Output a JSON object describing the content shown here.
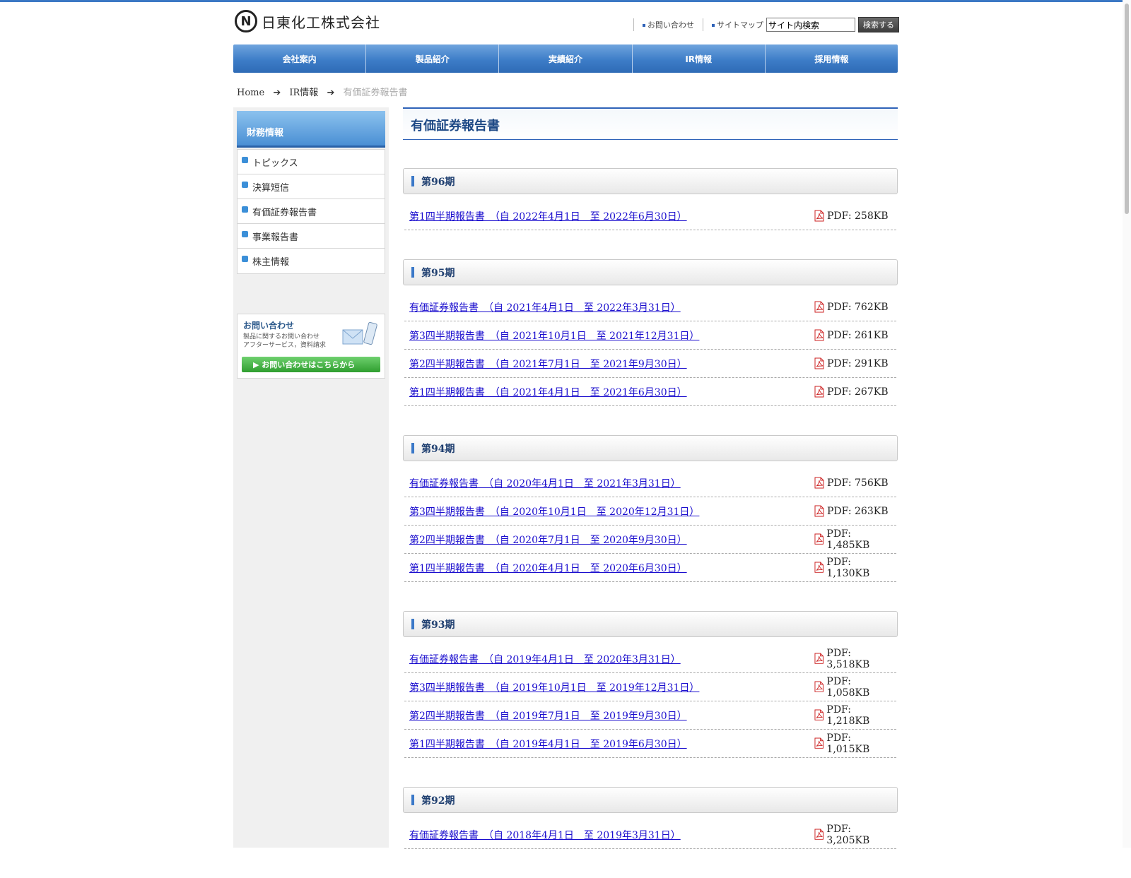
{
  "header": {
    "logo_mark": "N",
    "company": "日東化工株式会社",
    "contact_link": "お問い合わせ",
    "sitemap_link": "サイトマップ",
    "search_value": "サイト内検索",
    "search_button": "検索する"
  },
  "nav": [
    "会社案内",
    "製品紹介",
    "実績紹介",
    "IR情報",
    "採用情報"
  ],
  "breadcrumb": {
    "home": "Home",
    "arrow": "➔",
    "section": "IR情報",
    "current": "有価証券報告書"
  },
  "sidebar": {
    "title": "財務情報",
    "items": [
      "トピックス",
      "決算短信",
      "有価証券報告書",
      "事業報告書",
      "株主情報"
    ],
    "contact": {
      "title": "お問い合わせ",
      "desc1": "製品に関するお問い合わせ",
      "desc2": "アフターサービス，資料請求",
      "button": "お問い合わせはこちらから"
    }
  },
  "page_title": "有価証券報告書",
  "periods": [
    {
      "title": "第96期",
      "docs": [
        {
          "label": "第1四半期報告書　（自 2022年4月1日　至 2022年6月30日）",
          "size": "PDF: 258KB"
        }
      ]
    },
    {
      "title": "第95期",
      "docs": [
        {
          "label": "有価証券報告書　（自 2021年4月1日　至 2022年3月31日）",
          "size": "PDF: 762KB"
        },
        {
          "label": "第3四半期報告書　（自 2021年10月1日　至 2021年12月31日）",
          "size": "PDF: 261KB"
        },
        {
          "label": "第2四半期報告書　（自 2021年7月1日　至 2021年9月30日）",
          "size": "PDF: 291KB"
        },
        {
          "label": "第1四半期報告書　（自 2021年4月1日　至 2021年6月30日）",
          "size": "PDF: 267KB"
        }
      ]
    },
    {
      "title": "第94期",
      "docs": [
        {
          "label": "有価証券報告書　（自 2020年4月1日　至 2021年3月31日）",
          "size": "PDF: 756KB"
        },
        {
          "label": "第3四半期報告書　（自 2020年10月1日　至 2020年12月31日）",
          "size": "PDF: 263KB"
        },
        {
          "label": "第2四半期報告書　（自 2020年7月1日　至 2020年9月30日）",
          "size": "PDF: 1,485KB"
        },
        {
          "label": "第1四半期報告書　（自 2020年4月1日　至 2020年6月30日）",
          "size": "PDF: 1,130KB"
        }
      ]
    },
    {
      "title": "第93期",
      "docs": [
        {
          "label": "有価証券報告書　（自 2019年4月1日　至 2020年3月31日）",
          "size": "PDF: 3,518KB"
        },
        {
          "label": "第3四半期報告書　（自 2019年10月1日　至 2019年12月31日）",
          "size": "PDF: 1,058KB"
        },
        {
          "label": "第2四半期報告書　（自 2019年7月1日　至 2019年9月30日）",
          "size": "PDF: 1,218KB"
        },
        {
          "label": "第1四半期報告書　（自 2019年4月1日　至 2019年6月30日）",
          "size": "PDF: 1,015KB"
        }
      ]
    },
    {
      "title": "第92期",
      "docs": [
        {
          "label": "有価証券報告書　（自 2018年4月1日　至 2019年3月31日）",
          "size": "PDF: 3,205KB"
        }
      ]
    }
  ],
  "colors": {
    "accent": "#2f63b8",
    "link": "#1a0dce",
    "contact_button": "#3aa83a"
  },
  "icons": {
    "pdf": "pdf-icon",
    "bullet": "sidebar-bullet-icon",
    "contact": "mail-phone-icon"
  }
}
